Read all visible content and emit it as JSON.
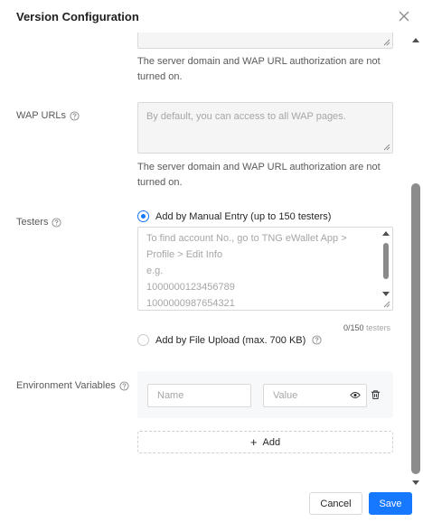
{
  "dialog": {
    "title": "Version Configuration"
  },
  "server_domain": {
    "hint": "The server domain and WAP URL authorization are not turned on."
  },
  "wap_urls": {
    "label": "WAP URLs",
    "placeholder": "By default, you can access to all WAP pages.",
    "hint": "The server domain and WAP URL authorization are not turned on."
  },
  "testers": {
    "label": "Testers",
    "option_manual": "Add by Manual Entry (up to 150 testers)",
    "option_upload": "Add by File Upload (max. 700 KB)",
    "selected": "manual",
    "placeholder_lines": [
      "To find account No., go to TNG eWallet App >",
      "Profile > Edit Info",
      "e.g.",
      "1000000123456789",
      "1000000987654321"
    ],
    "count": "0/150",
    "count_unit": "testers"
  },
  "env_vars": {
    "label": "Environment Variables",
    "name_placeholder": "Name",
    "value_placeholder": "Value",
    "add_label": "Add"
  },
  "footer": {
    "cancel": "Cancel",
    "save": "Save"
  },
  "colors": {
    "primary": "#1677ff"
  }
}
